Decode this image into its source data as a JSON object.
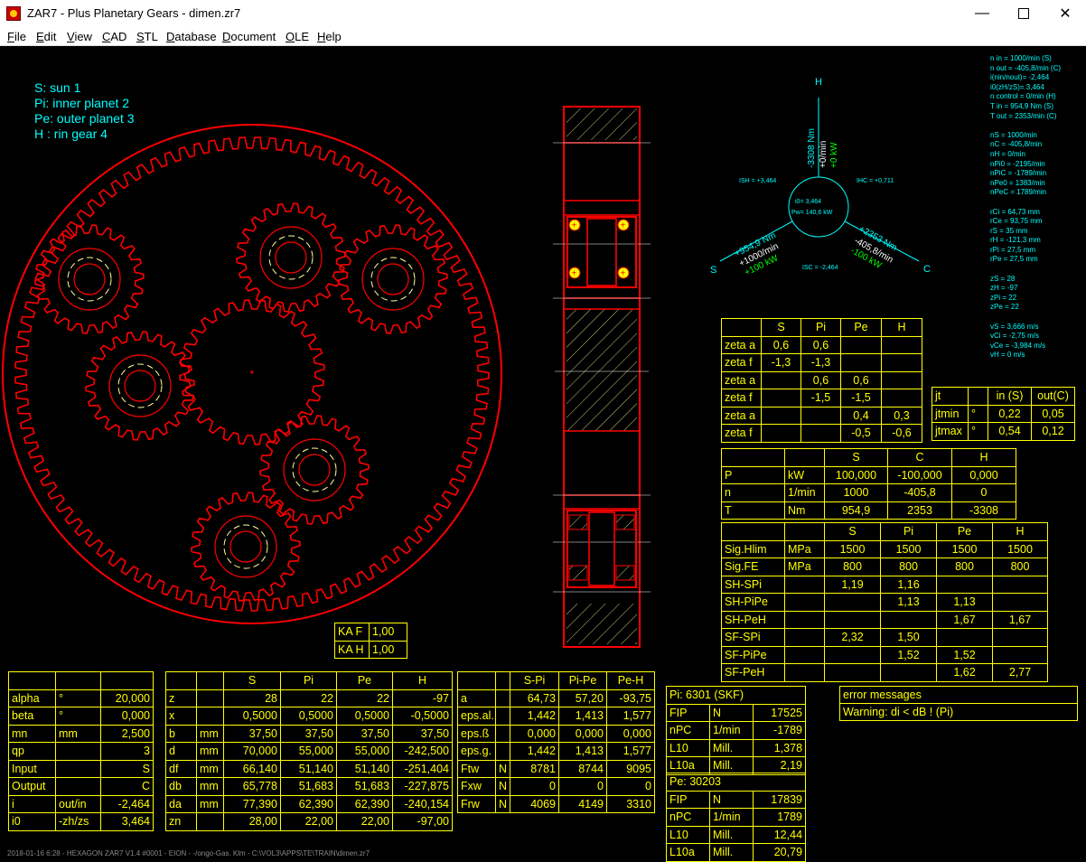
{
  "window": {
    "title": "ZAR7 - Plus Planetary Gears  -  dimen.zr7",
    "minimize_icon": "minimize-icon",
    "maximize_icon": "maximize-icon",
    "close_icon": "close-icon"
  },
  "menu": [
    "File",
    "Edit",
    "View",
    "CAD",
    "STL",
    "Database",
    "Document",
    "OLE",
    "Help"
  ],
  "legend": [
    "S: sun 1",
    "Pi: inner planet 2",
    "Pe: outer planet 3",
    "H : rin gear 4"
  ],
  "diagram": {
    "H": "H",
    "S": "S",
    "C": "C",
    "center1": "i0= 3,464",
    "center2": "Pw= 140,6 kW",
    "h_nm": "-3308 Nm",
    "h_min": "+0/min",
    "h_kw": "+0 kW",
    "s_nm": "+954,9 Nm",
    "s_min": "+1000/min",
    "s_kw": "+100 kW",
    "c_nm": "+2353 Nm",
    "c_min": "-405,8/min",
    "c_kw": "-100 kW",
    "ish": "ISH = +3,464",
    "ihc": "IHC = +0,711",
    "isc": "ISC = -2,464"
  },
  "info": [
    "n in = 1000/min (S)",
    "n out = -405,8/min (C)",
    "i(nin/nout)= -2,464",
    "i0(zH/zS)= 3,464",
    "n control = 0/min (H)",
    "T in = 954,9 Nm (S)",
    "T out = 2353/min (C)",
    "",
    "nS = 1000/min",
    "nC = -405,8/min",
    "nH = 0/min",
    "nPi0 = -2195/min",
    "nPiC = -1789/min",
    "nPe0 = 1383/min",
    "nPeC = 1789/min",
    "",
    "rCi = 64,73 mm",
    "rCe = 93,75 mm",
    "rS = 35 mm",
    "rH = -121,3 mm",
    "rPi = 27,5 mm",
    "rPe = 27,5 mm",
    "",
    "zS = 28",
    "zH = -97",
    "zPi = 22",
    "zPe = 22",
    "",
    "vS = 3,666 m/s",
    "vCi = -2,75 m/s",
    "vCe = -3,984 m/s",
    "vH = 0 m/s"
  ],
  "zeta_table": [
    [
      "",
      "S",
      "Pi",
      "Pe",
      "H"
    ],
    [
      "zeta a",
      "0,6",
      "0,6",
      "",
      ""
    ],
    [
      "zeta f",
      "-1,3",
      "-1,3",
      "",
      ""
    ],
    [
      "zeta a",
      "",
      "0,6",
      "0,6",
      ""
    ],
    [
      "zeta f",
      "",
      "-1,5",
      "-1,5",
      ""
    ],
    [
      "zeta a",
      "",
      "",
      "0,4",
      "0,3"
    ],
    [
      "zeta f",
      "",
      "",
      "-0,5",
      "-0,6"
    ]
  ],
  "jt_table": [
    [
      "jt",
      "",
      "in (S)",
      "out(C)"
    ],
    [
      "jtmin",
      "°",
      "0,22",
      "0,05"
    ],
    [
      "jtmax",
      "°",
      "0,54",
      "0,12"
    ]
  ],
  "power_table": [
    [
      "",
      "",
      "S",
      "C",
      "H"
    ],
    [
      "P",
      "kW",
      "100,000",
      "-100,000",
      "0,000"
    ],
    [
      "n",
      "1/min",
      "1000",
      "-405,8",
      "0"
    ],
    [
      "T",
      "Nm",
      "954,9",
      "2353",
      "-3308"
    ]
  ],
  "strength_table": [
    [
      "",
      "",
      "S",
      "Pi",
      "Pe",
      "H"
    ],
    [
      "Sig.Hlim",
      "MPa",
      "1500",
      "1500",
      "1500",
      "1500"
    ],
    [
      "Sig.FE",
      "MPa",
      "800",
      "800",
      "800",
      "800"
    ],
    [
      "SH-SPi",
      "",
      "1,19",
      "1,16",
      "",
      ""
    ],
    [
      "SH-PiPe",
      "",
      "",
      "1,13",
      "1,13",
      ""
    ],
    [
      "SH-PeH",
      "",
      "",
      "",
      "1,67",
      "1,67"
    ],
    [
      "SF-SPi",
      "",
      "2,32",
      "1,50",
      "",
      ""
    ],
    [
      "SF-PiPe",
      "",
      "",
      "1,52",
      "1,52",
      ""
    ],
    [
      "SF-PeH",
      "",
      "",
      "",
      "1,62",
      "2,77"
    ]
  ],
  "ka_table": [
    [
      "KA F",
      "1,00"
    ],
    [
      "KA H",
      "1,00"
    ]
  ],
  "basic_table": [
    [
      "",
      "",
      ""
    ],
    [
      "alpha",
      "°",
      "20,000"
    ],
    [
      "beta",
      "°",
      "0,000"
    ],
    [
      "mn",
      "mm",
      "2,500"
    ],
    [
      "qp",
      "",
      "3"
    ],
    [
      "Input",
      "",
      "S"
    ],
    [
      "Output",
      "",
      "C"
    ],
    [
      "i",
      "out/in",
      "-2,464"
    ],
    [
      "i0",
      "-zh/zs",
      "3,464"
    ]
  ],
  "gear_table": [
    [
      "",
      "",
      "S",
      "Pi",
      "Pe",
      "H"
    ],
    [
      "z",
      "",
      "28",
      "22",
      "22",
      "-97"
    ],
    [
      "x",
      "",
      "0,5000",
      "0,5000",
      "0,5000",
      "-0,5000"
    ],
    [
      "b",
      "mm",
      "37,50",
      "37,50",
      "37,50",
      "37,50"
    ],
    [
      "d",
      "mm",
      "70,000",
      "55,000",
      "55,000",
      "-242,500"
    ],
    [
      "df",
      "mm",
      "66,140",
      "51,140",
      "51,140",
      "-251,404"
    ],
    [
      "db",
      "mm",
      "65,778",
      "51,683",
      "51,683",
      "-227,875"
    ],
    [
      "da",
      "mm",
      "77,390",
      "62,390",
      "62,390",
      "-240,154"
    ],
    [
      "zn",
      "",
      "28,00",
      "22,00",
      "22,00",
      "-97,00"
    ]
  ],
  "mesh_table": [
    [
      "",
      "",
      "S-Pi",
      "Pi-Pe",
      "Pe-H"
    ],
    [
      "a",
      "",
      "64,73",
      "57,20",
      "-93,75"
    ],
    [
      "eps.al.",
      "",
      "1,442",
      "1,413",
      "1,577"
    ],
    [
      "eps.ß",
      "",
      "0,000",
      "0,000",
      "0,000"
    ],
    [
      "eps.g.",
      "",
      "1,442",
      "1,413",
      "1,577"
    ],
    [
      "Ftw",
      "N",
      "8781",
      "8744",
      "9095"
    ],
    [
      "Fxw",
      "N",
      "0",
      "0",
      "0"
    ],
    [
      "Frw",
      "N",
      "4069",
      "4149",
      "3310"
    ]
  ],
  "bearing_pi": [
    [
      "Pi: 6301 (SKF)",
      "",
      ""
    ],
    [
      "FIP",
      "N",
      "17525"
    ],
    [
      "nPC",
      "1/min",
      "-1789"
    ],
    [
      "L10",
      "Mill.",
      "1,378"
    ],
    [
      "L10a",
      "Mill.",
      "2,19"
    ]
  ],
  "bearing_pe": [
    [
      "Pe: 30203",
      "",
      ""
    ],
    [
      "FIP",
      "N",
      "17839"
    ],
    [
      "nPC",
      "1/min",
      "1789"
    ],
    [
      "L10",
      "Mill.",
      "12,44"
    ],
    [
      "L10a",
      "Mill.",
      "20,79"
    ]
  ],
  "messages": {
    "title": "error messages",
    "text": "Warning: di < dB ! (Pi)"
  },
  "status": "2018-01-16 6:28 - HEXAGON ZAR7 V1.4 #0001 - EION - -/ongo-Gas. Klm - C:\\VOL3\\APPS\\TE\\TRAIN\\dimen.zr7",
  "colors": {
    "gear": "#ff0000",
    "table": "#ffff00",
    "info": "#00ffff",
    "bg": "#000000",
    "dash": "#ffff99"
  }
}
